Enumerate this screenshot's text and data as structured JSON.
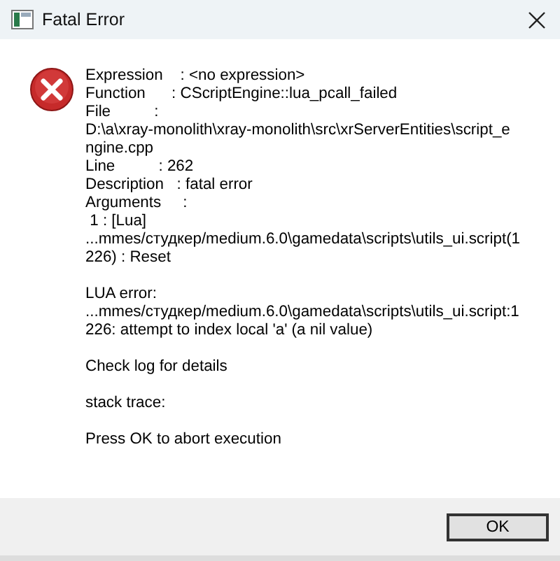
{
  "window": {
    "title": "Fatal Error"
  },
  "message": [
    [
      "Expression    : <no expression>",
      "Function      : CScriptEngine::lua_pcall_failed",
      "File          :",
      "D:\\a\\xray-monolith\\xray-monolith\\src\\xrServerEntities\\script_e",
      "ngine.cpp",
      "Line          : 262",
      "Description   : fatal error",
      "Arguments     :",
      " 1 : [Lua]",
      "...mmes/студкер/medium.6.0\\gamedata\\scripts\\utils_ui.script(1",
      "226) : Reset"
    ],
    [
      "LUA error:",
      "...mmes/студкер/medium.6.0\\gamedata\\scripts\\utils_ui.script:1",
      "226: attempt to index local 'a' (a nil value)"
    ],
    [
      "Check log for details"
    ],
    [
      "stack trace:"
    ],
    [
      "Press OK to abort execution"
    ]
  ],
  "buttons": [
    {
      "label": "OK",
      "selected": true
    }
  ]
}
